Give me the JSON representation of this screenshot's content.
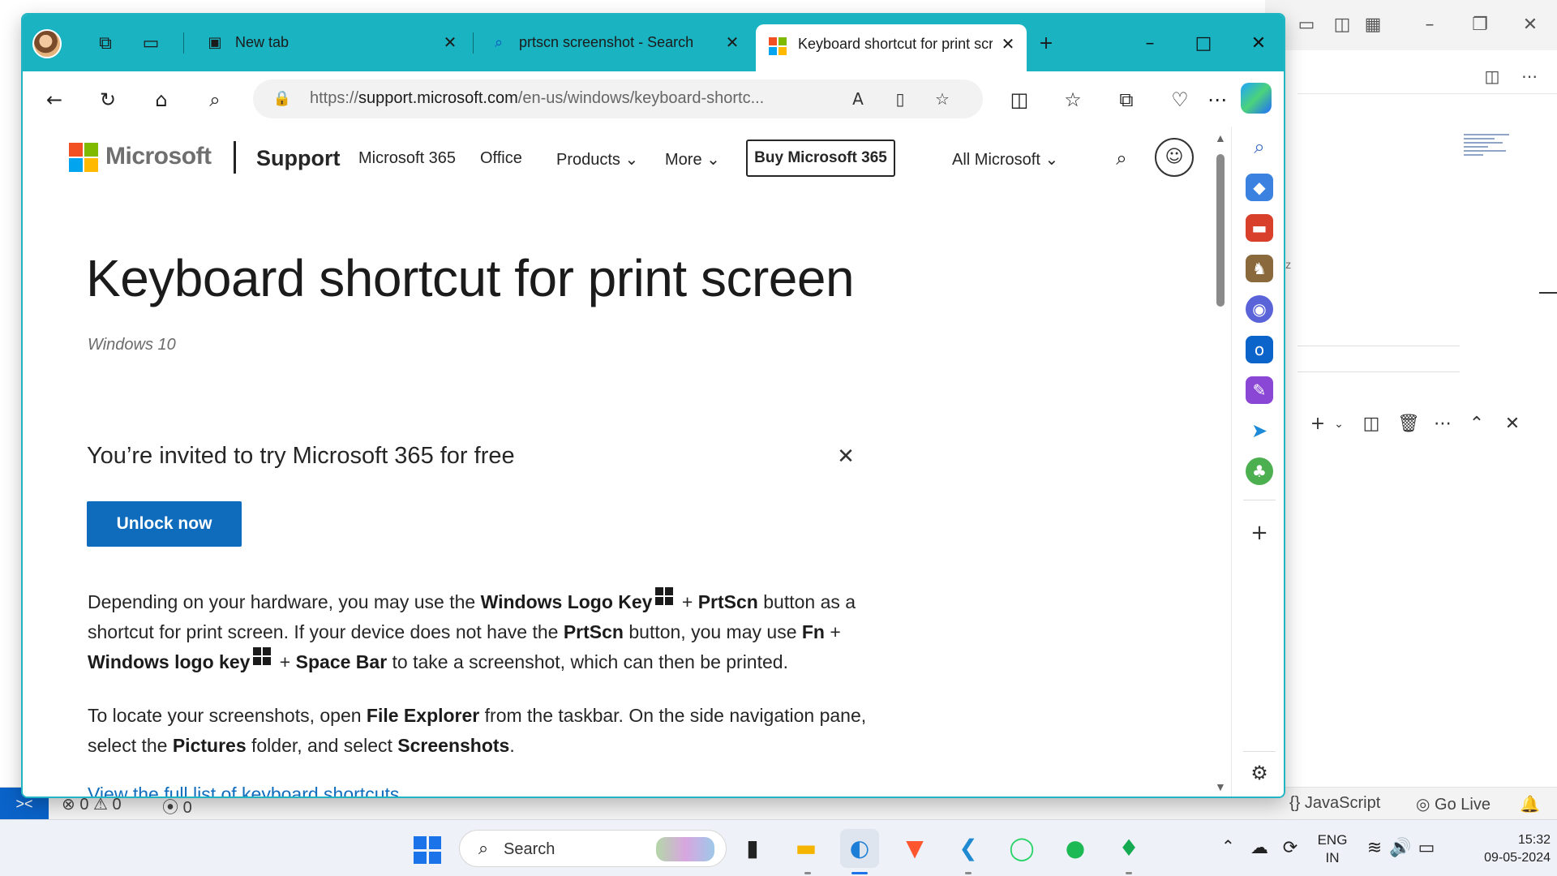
{
  "browser": {
    "tabs": [
      {
        "label": "New tab",
        "icon": "new-tab-icon"
      },
      {
        "label": "prtscn screenshot - Search",
        "icon": "search-icon"
      },
      {
        "label": "Keyboard shortcut for print scr",
        "icon": "microsoft-logo-icon",
        "active": true
      }
    ],
    "url_prefix": "https://",
    "url_domain": "support.microsoft.com",
    "url_path": "/en-us/windows/keyboard-shortc..."
  },
  "site_header": {
    "logo_text": "Microsoft",
    "support": "Support",
    "links": [
      "Microsoft 365",
      "Office",
      "Products",
      "More"
    ],
    "buy_button": "Buy Microsoft 365",
    "all_microsoft": "All Microsoft"
  },
  "article": {
    "title": "Keyboard shortcut for print screen",
    "subtitle": "Windows 10",
    "promo_text": "You’re invited to try Microsoft 365 for free",
    "promo_button": "Unlock now",
    "p1_a": "Depending on your hardware, you may use the ",
    "p1_b": "Windows Logo Key",
    "p1_c": " + ",
    "p1_d": "PrtScn",
    "p1_e": " button as a shortcut for print screen. If your device does not have the ",
    "p1_f": "PrtScn",
    "p1_g": " button, you may use ",
    "p1_h": "Fn",
    "p1_i": " + ",
    "p1_j": "Windows logo key",
    "p1_k": " + ",
    "p1_l": "Space Bar",
    "p1_m": " to take a screenshot, which can then be printed.",
    "p2_a": "To locate your screenshots, open ",
    "p2_b": "File Explorer",
    "p2_c": " from the taskbar. On the side navigation pane, select the ",
    "p2_d": "Pictures",
    "p2_e": " folder, and select ",
    "p2_f": "Screenshots",
    "p2_g": ".",
    "link": "View the full list of keyboard shortcuts"
  },
  "editor_status": {
    "problems": "⊗ 0 ⚠ 0",
    "ports": "0",
    "language": "JavaScript",
    "go_live": "Go Live"
  },
  "taskbar": {
    "search_label": "Search",
    "lang_line1": "ENG",
    "lang_line2": "IN",
    "time": "15:32",
    "date": "09-05-2024"
  },
  "colors": {
    "tab_strip": "#1ab3c1",
    "ms_red": "#f25022",
    "ms_green": "#7fba00",
    "ms_blue": "#00a4ef",
    "ms_yellow": "#ffb900",
    "button_blue": "#0f6cbd"
  }
}
